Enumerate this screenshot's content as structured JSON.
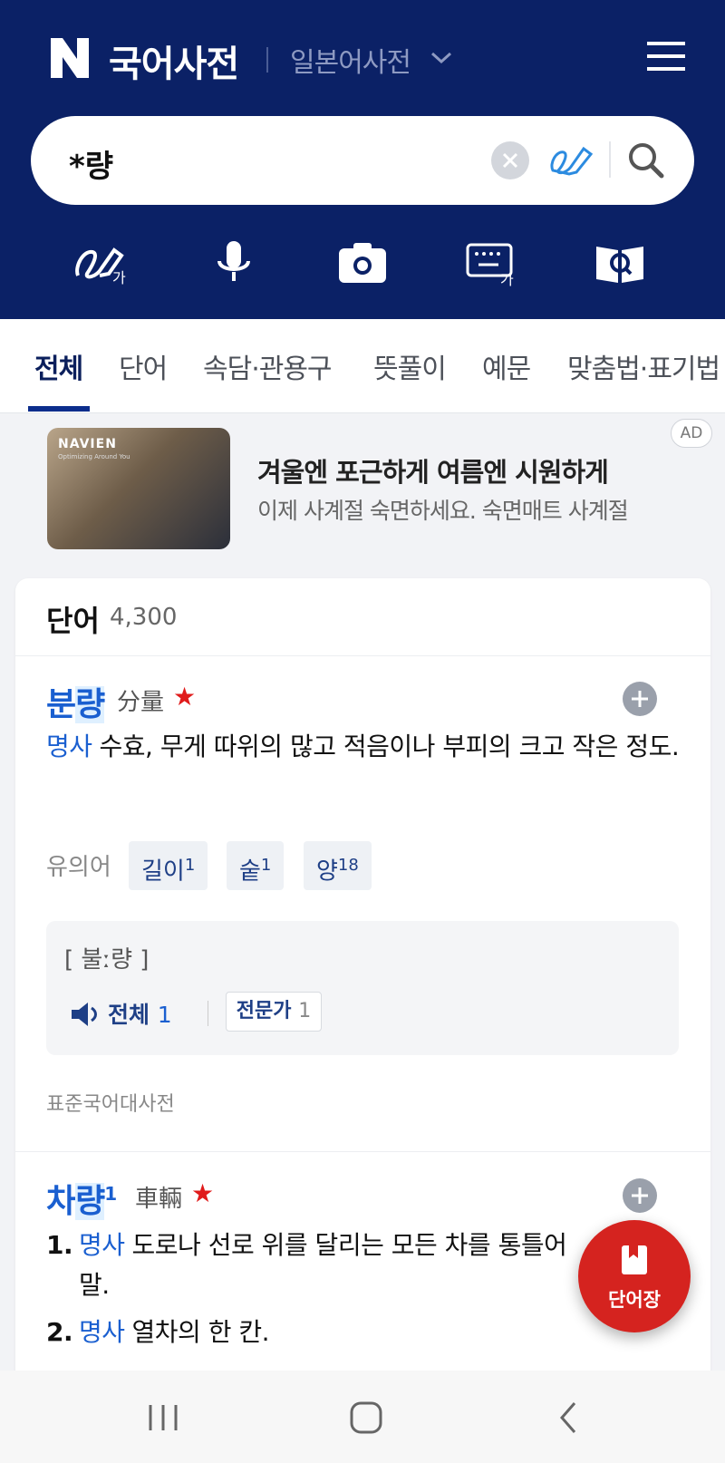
{
  "header": {
    "logo": "N",
    "title": "국어사전",
    "subtitle": "일본어사전",
    "search": {
      "value": "*량"
    },
    "tools": [
      "handwriting-input-icon",
      "microphone-icon",
      "camera-icon",
      "keyboard-input-icon",
      "dictionary-search-icon"
    ]
  },
  "tabs": [
    "전체",
    "단어",
    "속담·관용구",
    "뜻풀이",
    "예문",
    "맞춤법·표기법"
  ],
  "ad": {
    "badge": "AD",
    "brand": "NAVIEN",
    "brand_tagline": "Optimizing Around You",
    "headline": "겨울엔 포근하게 여름엔 시원하게",
    "subtext": "이제 사계절 숙면하세요. 숙면매트 사계절"
  },
  "section": {
    "title": "단어",
    "count": "4,300"
  },
  "entries": [
    {
      "word_before": "분",
      "word_highlight": "량",
      "hanja": "分量",
      "pos": "명사",
      "definition": "수효, 무게 따위의 많고 적음이나 부피의 크고 작은 정도.",
      "synonyms_label": "유의어",
      "synonyms": [
        {
          "word": "길이",
          "sup": "1"
        },
        {
          "word": "숱",
          "sup": "1"
        },
        {
          "word": "양",
          "sup": "18"
        }
      ],
      "pronunciation": "[ 불ː량 ]",
      "pron_all_label": "전체",
      "pron_all_count": "1",
      "pron_expert_label": "전문가",
      "pron_expert_count": "1",
      "source": "표준국어대사전"
    },
    {
      "word_before": "차",
      "word_highlight": "량",
      "sup": "1",
      "hanja": "車輛",
      "senses": [
        {
          "num": "1.",
          "pos": "명사",
          "text": "도로나 선로 위를 달리는 모든 차를 통틀어",
          "cont": "말."
        },
        {
          "num": "2.",
          "pos": "명사",
          "text": "열차의 한 칸."
        }
      ]
    }
  ],
  "fab": {
    "label": "단어장"
  },
  "colors": {
    "header_bg": "#0b2166",
    "accent_blue": "#1a5fd0",
    "star_red": "#e01b1b",
    "fab_red": "#d5231f"
  }
}
